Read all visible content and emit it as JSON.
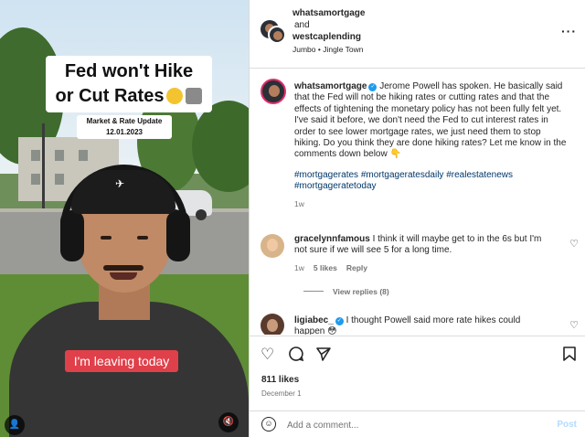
{
  "video": {
    "title_line1": "Fed won't Hike",
    "title_line2": "or Cut Rates",
    "subtitle_line1": "Market & Rate Update",
    "subtitle_line2": "12.01.2023",
    "caption": "I'm leaving today",
    "icons": [
      "thinking-emoji",
      "bank-emoji",
      "user-tag-icon",
      "mute-icon"
    ]
  },
  "header": {
    "user1": "whatsamortgage",
    "and_text": "and",
    "user2": "westcaplending",
    "audio": "Jumbo • Jingle Town",
    "more_icon": "ellipsis-icon"
  },
  "caption_post": {
    "username": "whatsamortgage",
    "text": "Jerome Powell has spoken. He basically said that the Fed will not be hiking rates or cutting rates and that the effects of tightening the monetary policy has not been fully felt yet. I've said it before, we don't need the Fed to cut interest rates in order to see lower mortgage rates, we just need them to stop hiking. Do you think they are done hiking rates? Let me know in the comments down below 👇",
    "hashtags_line1": "#mortgagerates #mortgageratesdaily #realestatenews",
    "hashtags_line2": "#mortgageratetoday",
    "time": "1w"
  },
  "comments": [
    {
      "username": "gracelynnfamous",
      "text_line1": "I think it will maybe get to in the 6s but I'm",
      "text_line2": "not sure if we will see 5 for a long time.",
      "time": "1w",
      "likes": "5 likes",
      "reply": "Reply",
      "view_replies": "View replies (8)"
    },
    {
      "username": "ligiabec_",
      "text_line1": "I thought Powell said more rate hikes could",
      "text_line2": "happen 😳"
    }
  ],
  "actions": {
    "likes": "811 likes",
    "date": "December 1",
    "icons": [
      "heart-icon",
      "comment-icon",
      "share-icon",
      "bookmark-icon"
    ]
  },
  "add_comment": {
    "placeholder": "Add a comment...",
    "post_label": "Post"
  },
  "colors": {
    "accent_link": "#00376b",
    "caption_bg": "#e0404a",
    "verified": "#1d9bf0",
    "post_disabled": "#b3dbff"
  }
}
